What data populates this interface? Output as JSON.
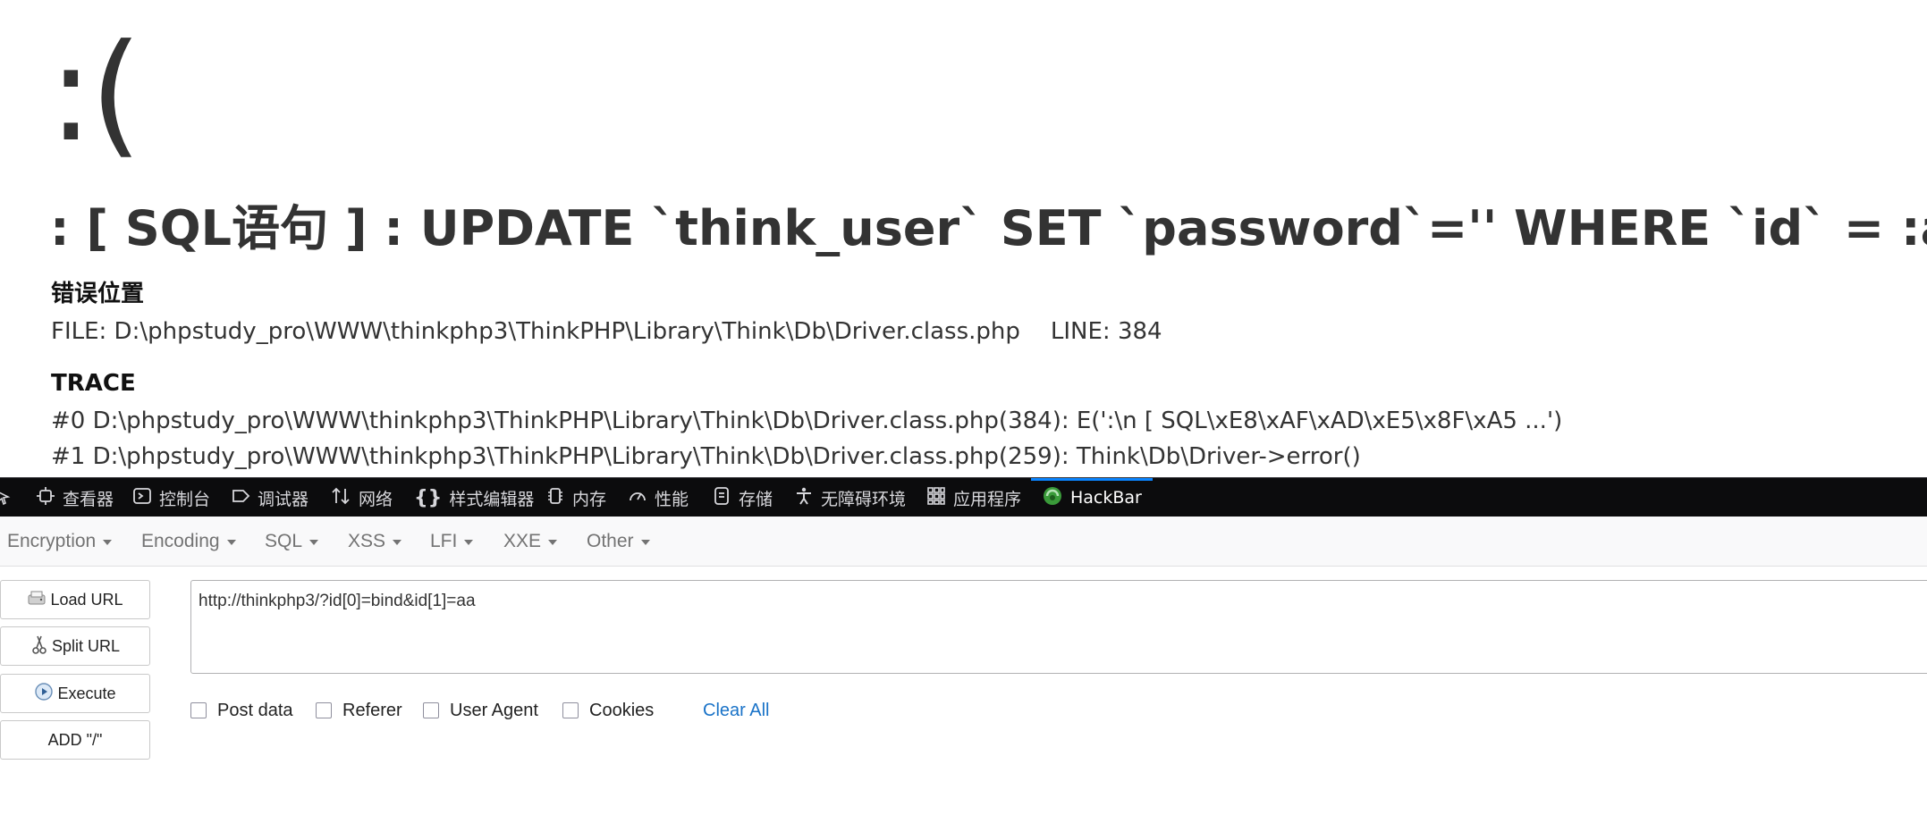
{
  "error_page": {
    "face": ":(",
    "message": ": [ SQL语句 ] : UPDATE `think_user` SET `password`='' WHERE `id` = :aa",
    "location_title": "错误位置",
    "file_label": "FILE: D:\\phpstudy_pro\\WWW\\thinkphp3\\ThinkPHP\\Library\\Think\\Db\\Driver.class.php",
    "line_label": "LINE: 384",
    "trace_title": "TRACE",
    "trace": [
      "#0 D:\\phpstudy_pro\\WWW\\thinkphp3\\ThinkPHP\\Library\\Think\\Db\\Driver.class.php(384): E(':\\n [ SQL\\xE8\\xAF\\xAD\\xE5\\x8F\\xA5 ...')",
      "#1 D:\\phpstudy_pro\\WWW\\thinkphp3\\ThinkPHP\\Library\\Think\\Db\\Driver.class.php(259): Think\\Db\\Driver->error()"
    ]
  },
  "devtools": {
    "tabs": [
      {
        "label": "查看器",
        "icon": "inspector-icon"
      },
      {
        "label": "控制台",
        "icon": "console-icon"
      },
      {
        "label": "调试器",
        "icon": "debugger-icon"
      },
      {
        "label": "网络",
        "icon": "network-icon"
      },
      {
        "label": "样式编辑器",
        "icon": "style-editor-icon"
      },
      {
        "label": "内存",
        "icon": "memory-icon"
      },
      {
        "label": "性能",
        "icon": "performance-icon"
      },
      {
        "label": "存储",
        "icon": "storage-icon"
      },
      {
        "label": "无障碍环境",
        "icon": "accessibility-icon"
      },
      {
        "label": "应用程序",
        "icon": "application-icon"
      },
      {
        "label": "HackBar",
        "icon": "hackbar-icon",
        "active": true
      }
    ],
    "active_color": "#0a84ff"
  },
  "hackbar": {
    "menu": [
      "Encryption",
      "Encoding",
      "SQL",
      "XSS",
      "LFI",
      "XXE",
      "Other"
    ],
    "buttons": [
      {
        "label": "Load URL",
        "icon": "load-url-icon"
      },
      {
        "label": "Split URL",
        "icon": "scissors-icon"
      },
      {
        "label": "Execute",
        "icon": "execute-icon"
      },
      {
        "label": "ADD \"/\"",
        "icon": ""
      }
    ],
    "url_value": "http://thinkphp3/?id[0]=bind&id[1]=aa",
    "options": [
      "Post data",
      "Referer",
      "User Agent",
      "Cookies"
    ],
    "clear_all": "Clear All",
    "link_color": "#1a73c8"
  }
}
